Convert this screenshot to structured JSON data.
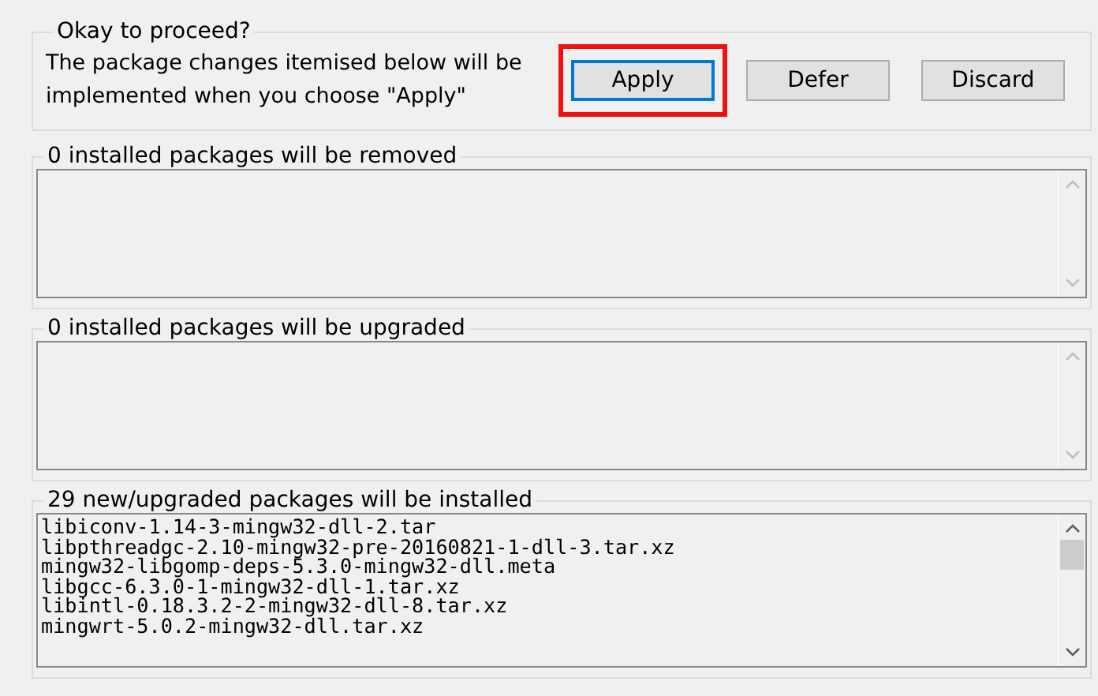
{
  "confirm": {
    "title": "Okay to proceed?",
    "message": "The package changes itemised below will be implemented when you choose \"Apply\"",
    "buttons": [
      {
        "label": "Apply",
        "focused": true,
        "highlighted": true
      },
      {
        "label": "Defer",
        "focused": false,
        "highlighted": false
      },
      {
        "label": "Discard",
        "focused": false,
        "highlighted": false
      }
    ]
  },
  "sections": [
    {
      "title": "0 installed packages will be removed"
    },
    {
      "title": "0 installed packages will be upgraded"
    },
    {
      "title": "29 new/upgraded packages will be installed",
      "lines": [
        "libiconv-1.14-3-mingw32-dll-2.tar",
        "libpthreadgc-2.10-mingw32-pre-20160821-1-dll-3.tar.xz",
        "mingw32-libgomp-deps-5.3.0-mingw32-dll.meta",
        "libgcc-6.3.0-1-mingw32-dll-1.tar.xz",
        "libintl-0.18.3.2-2-mingw32-dll-8.tar.xz",
        "mingwrt-5.0.2-mingw32-dll.tar.xz"
      ]
    }
  ]
}
